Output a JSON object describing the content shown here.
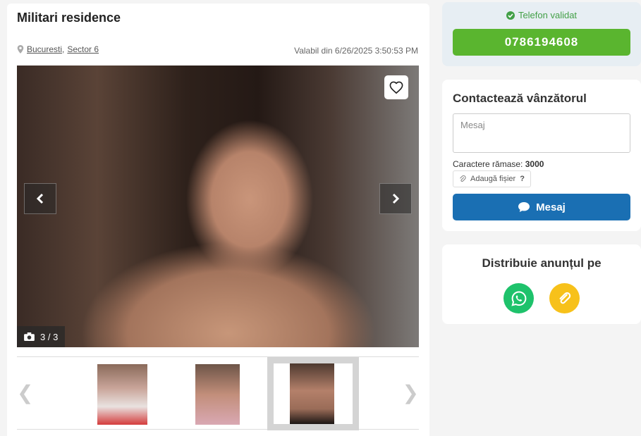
{
  "listing": {
    "title": "Militari residence",
    "location_city": "Bucuresti",
    "location_separator": ",",
    "location_sector": "Sector 6",
    "valid_from": "Valabil din 6/26/2025 3:50:53 PM"
  },
  "gallery": {
    "counter": "3 / 3",
    "prev_glyph": "❮",
    "next_glyph": "❯"
  },
  "phone": {
    "validated_label": "Telefon validat",
    "number": "0786194608",
    "accent": "#5ab52f"
  },
  "contact": {
    "title": "Contactează vânzătorul",
    "message_placeholder": "Mesaj",
    "chars_label": "Caractere rămase:",
    "chars_remaining": "3000",
    "attach_label": "Adaugă fișier",
    "attach_help": "?",
    "send_label": "Mesaj",
    "accent": "#1a6fb3"
  },
  "share": {
    "title": "Distribuie anunțul pe",
    "icons": [
      "whatsapp-icon",
      "link-icon"
    ]
  }
}
